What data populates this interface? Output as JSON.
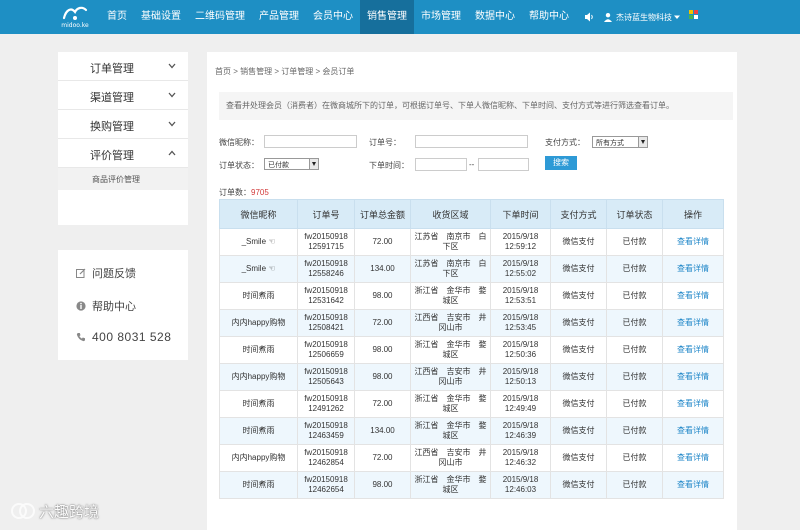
{
  "header": {
    "logo_text": "midoo.ke",
    "nav": [
      {
        "label": "首页",
        "active": false
      },
      {
        "label": "基础设置",
        "active": false
      },
      {
        "label": "二维码管理",
        "active": false
      },
      {
        "label": "产品管理",
        "active": false
      },
      {
        "label": "会员中心",
        "active": false
      },
      {
        "label": "销售管理",
        "active": true
      },
      {
        "label": "市场管理",
        "active": false
      },
      {
        "label": "数据中心",
        "active": false
      },
      {
        "label": "帮助中心",
        "active": false
      }
    ],
    "user_name": "杰诗蓝生物科技"
  },
  "sidebar": {
    "items": [
      {
        "label": "订单管理",
        "icon": "chevron-down-icon"
      },
      {
        "label": "渠道管理",
        "icon": "chevron-down-icon"
      },
      {
        "label": "换购管理",
        "icon": "chevron-down-icon"
      },
      {
        "label": "评价管理",
        "icon": "chevron-up-icon"
      }
    ],
    "sub_item": "商品评价管理"
  },
  "help": {
    "feedback": "问题反馈",
    "help_center": "帮助中心",
    "phone": "400 8031 528"
  },
  "breadcrumb": "首页 > 销售管理 > 订单管理 > 会员订单",
  "info_text": "查看并处理会员（消费者）在微商城所下的订单，可根据订单号、下单人微信昵称、下单时间、支付方式等进行筛选查看订单。",
  "filters": {
    "nickname_label": "微信昵称：",
    "order_no_label": "订单号：",
    "pay_label": "支付方式：",
    "pay_value": "所有方式",
    "status_label": "订单状态：",
    "status_value": "已付款",
    "time_label": "下单时间：",
    "time_sep": "--",
    "search_label": "搜索"
  },
  "count_label": "订单数：",
  "count_value": "9705",
  "table": {
    "headers": [
      "微信昵称",
      "订单号",
      "订单总金额",
      "收货区域",
      "下单时间",
      "支付方式",
      "订单状态",
      "操作"
    ],
    "rows": [
      [
        "_Smile ☜",
        "fw20150918\n12591715",
        "72.00",
        "江苏省　南京市　白\n下区",
        "2015/9/18\n12:59:12",
        "微信支付",
        "已付款",
        "查看详情"
      ],
      [
        "_Smile ☜",
        "fw20150918\n12558246",
        "134.00",
        "江苏省　南京市　白\n下区",
        "2015/9/18\n12:55:02",
        "微信支付",
        "已付款",
        "查看详情"
      ],
      [
        "时间煮雨",
        "fw20150918\n12531642",
        "98.00",
        "浙江省　金华市　婺\n城区",
        "2015/9/18\n12:53:51",
        "微信支付",
        "已付款",
        "查看详情"
      ],
      [
        "内内happy购物",
        "fw20150918\n12508421",
        "72.00",
        "江西省　吉安市　井\n冈山市",
        "2015/9/18\n12:53:45",
        "微信支付",
        "已付款",
        "查看详情"
      ],
      [
        "时间煮雨",
        "fw20150918\n12506659",
        "98.00",
        "浙江省　金华市　婺\n城区",
        "2015/9/18\n12:50:36",
        "微信支付",
        "已付款",
        "查看详情"
      ],
      [
        "内内happy购物",
        "fw20150918\n12505643",
        "98.00",
        "江西省　吉安市　井\n冈山市",
        "2015/9/18\n12:50:13",
        "微信支付",
        "已付款",
        "查看详情"
      ],
      [
        "时间煮雨",
        "fw20150918\n12491262",
        "72.00",
        "浙江省　金华市　婺\n城区",
        "2015/9/18\n12:49:49",
        "微信支付",
        "已付款",
        "查看详情"
      ],
      [
        "时间煮雨",
        "fw20150918\n12463459",
        "134.00",
        "浙江省　金华市　婺\n城区",
        "2015/9/18\n12:46:39",
        "微信支付",
        "已付款",
        "查看详情"
      ],
      [
        "内内happy购物",
        "fw20150918\n12462854",
        "72.00",
        "江西省　吉安市　井\n冈山市",
        "2015/9/18\n12:46:32",
        "微信支付",
        "已付款",
        "查看详情"
      ],
      [
        "时间煮雨",
        "fw20150918\n12462654",
        "98.00",
        "浙江省　金华市　婺\n城区",
        "2015/9/18\n12:46:03",
        "微信支付",
        "已付款",
        "查看详情"
      ]
    ]
  },
  "watermark": "六趣跨境",
  "colors": {
    "header_bg": "#1e8fc4",
    "nav_active": "#166f9c",
    "table_header": "#d8ebf7",
    "row_alt": "#eef7fd",
    "link": "#1e86c8",
    "count": "#d23a3a",
    "button": "#2e9ad6"
  }
}
